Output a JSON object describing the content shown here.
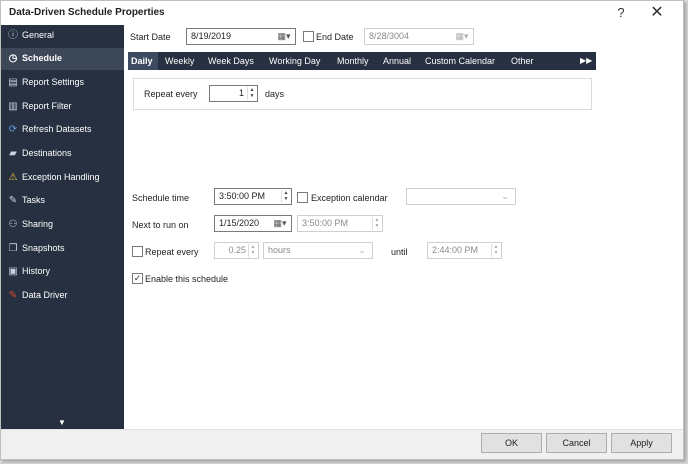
{
  "window": {
    "title": "Data-Driven Schedule Properties",
    "help_glyph": "?",
    "close_glyph": "✕"
  },
  "sidebar": {
    "items": [
      {
        "label": "General",
        "icon": "info-icon",
        "glyph": "ⓘ",
        "color": "#b7c7dd"
      },
      {
        "label": "Schedule",
        "icon": "clock-icon",
        "glyph": "◷",
        "color": "#ffffff"
      },
      {
        "label": "Report Settings",
        "icon": "report-settings-icon",
        "glyph": "▤",
        "color": "#c9d3e0"
      },
      {
        "label": "Report Filter",
        "icon": "filter-icon",
        "glyph": "▥",
        "color": "#c9d3e0"
      },
      {
        "label": "Refresh Datasets",
        "icon": "refresh-icon",
        "glyph": "⟳",
        "color": "#5aa0e6"
      },
      {
        "label": "Destinations",
        "icon": "destinations-icon",
        "glyph": "▰",
        "color": "#c9d3e0"
      },
      {
        "label": "Exception Handling",
        "icon": "warning-icon",
        "glyph": "⚠",
        "color": "#f3c33b"
      },
      {
        "label": "Tasks",
        "icon": "tasks-icon",
        "glyph": "✎",
        "color": "#c9d3e0"
      },
      {
        "label": "Sharing",
        "icon": "sharing-icon",
        "glyph": "⚇",
        "color": "#c9d3e0"
      },
      {
        "label": "Snapshots",
        "icon": "snapshots-icon",
        "glyph": "❐",
        "color": "#c9d3e0"
      },
      {
        "label": "History",
        "icon": "history-icon",
        "glyph": "▣",
        "color": "#c9d3e0"
      },
      {
        "label": "Data Driver",
        "icon": "data-driver-icon",
        "glyph": "✎",
        "color": "#e0452c"
      }
    ],
    "active_index": 1,
    "scroll_glyph": "▼"
  },
  "schedule": {
    "start_date": {
      "label": "Start Date",
      "value": "8/19/2019"
    },
    "end_date": {
      "label": "End Date",
      "value": "8/28/3004",
      "checked": false
    },
    "tabs": [
      "Daily",
      "Weekly",
      "Week Days",
      "Working Day",
      "Monthly",
      "Annual",
      "Custom Calendar",
      "Other"
    ],
    "active_tab": "Daily",
    "more_glyph": "▶▶",
    "repeat_every": {
      "label": "Repeat every",
      "value": "1",
      "unit": "days"
    },
    "schedule_time": {
      "label": "Schedule time",
      "value": "3:50:00 PM"
    },
    "exception_calendar": {
      "label": "Exception calendar",
      "value": "",
      "checked": false
    },
    "next_to_run": {
      "label": "Next to run on",
      "date": "1/15/2020",
      "time": "3:50:00 PM"
    },
    "repeat": {
      "label": "Repeat every",
      "value": "0.25",
      "unit": "hours",
      "until_label": "until",
      "until_value": "2:44:00 PM",
      "checked": false
    },
    "enable": {
      "label": "Enable this schedule",
      "checked": true
    }
  },
  "footer": {
    "ok": "OK",
    "cancel": "Cancel",
    "apply": "Apply"
  },
  "colors": {
    "sidebar_bg": "#263040",
    "sidebar_active": "#3c4758",
    "tab_active": "#3d4a5f"
  }
}
